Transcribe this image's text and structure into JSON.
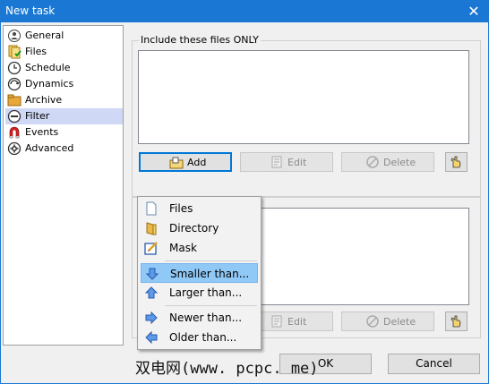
{
  "window": {
    "title": "New task",
    "close_glyph": "✕"
  },
  "nav": {
    "items": [
      {
        "label": "General",
        "icon": "general-icon"
      },
      {
        "label": "Files",
        "icon": "files-icon"
      },
      {
        "label": "Schedule",
        "icon": "schedule-icon"
      },
      {
        "label": "Dynamics",
        "icon": "dynamics-icon"
      },
      {
        "label": "Archive",
        "icon": "archive-icon"
      },
      {
        "label": "Filter",
        "icon": "filter-icon",
        "selected": true
      },
      {
        "label": "Events",
        "icon": "events-icon"
      },
      {
        "label": "Advanced",
        "icon": "advanced-icon"
      }
    ]
  },
  "include_group": {
    "label": "Include these files ONLY",
    "add_label": "Add",
    "edit_label": "Edit",
    "delete_label": "Delete"
  },
  "exclude_group": {
    "edit_label": "Edit",
    "delete_label": "Delete"
  },
  "add_menu": {
    "items": [
      {
        "label": "Files",
        "icon": "file-icon"
      },
      {
        "label": "Directory",
        "icon": "folder-icon"
      },
      {
        "label": "Mask",
        "icon": "mask-icon"
      },
      {
        "label": "Smaller than...",
        "icon": "arrow-down-icon",
        "highlighted": true
      },
      {
        "label": "Larger than...",
        "icon": "arrow-up-icon"
      },
      {
        "label": "Newer than...",
        "icon": "arrow-right-icon"
      },
      {
        "label": "Older than...",
        "icon": "arrow-left-icon"
      }
    ]
  },
  "footer": {
    "ok_label": "OK",
    "cancel_label": "Cancel"
  },
  "watermark": {
    "text": "双电网(www. pcpc. me)"
  },
  "colors": {
    "titlebar": "#1a78d4",
    "selection": "#cfd8f5",
    "menu_highlight": "#90c8f6"
  }
}
